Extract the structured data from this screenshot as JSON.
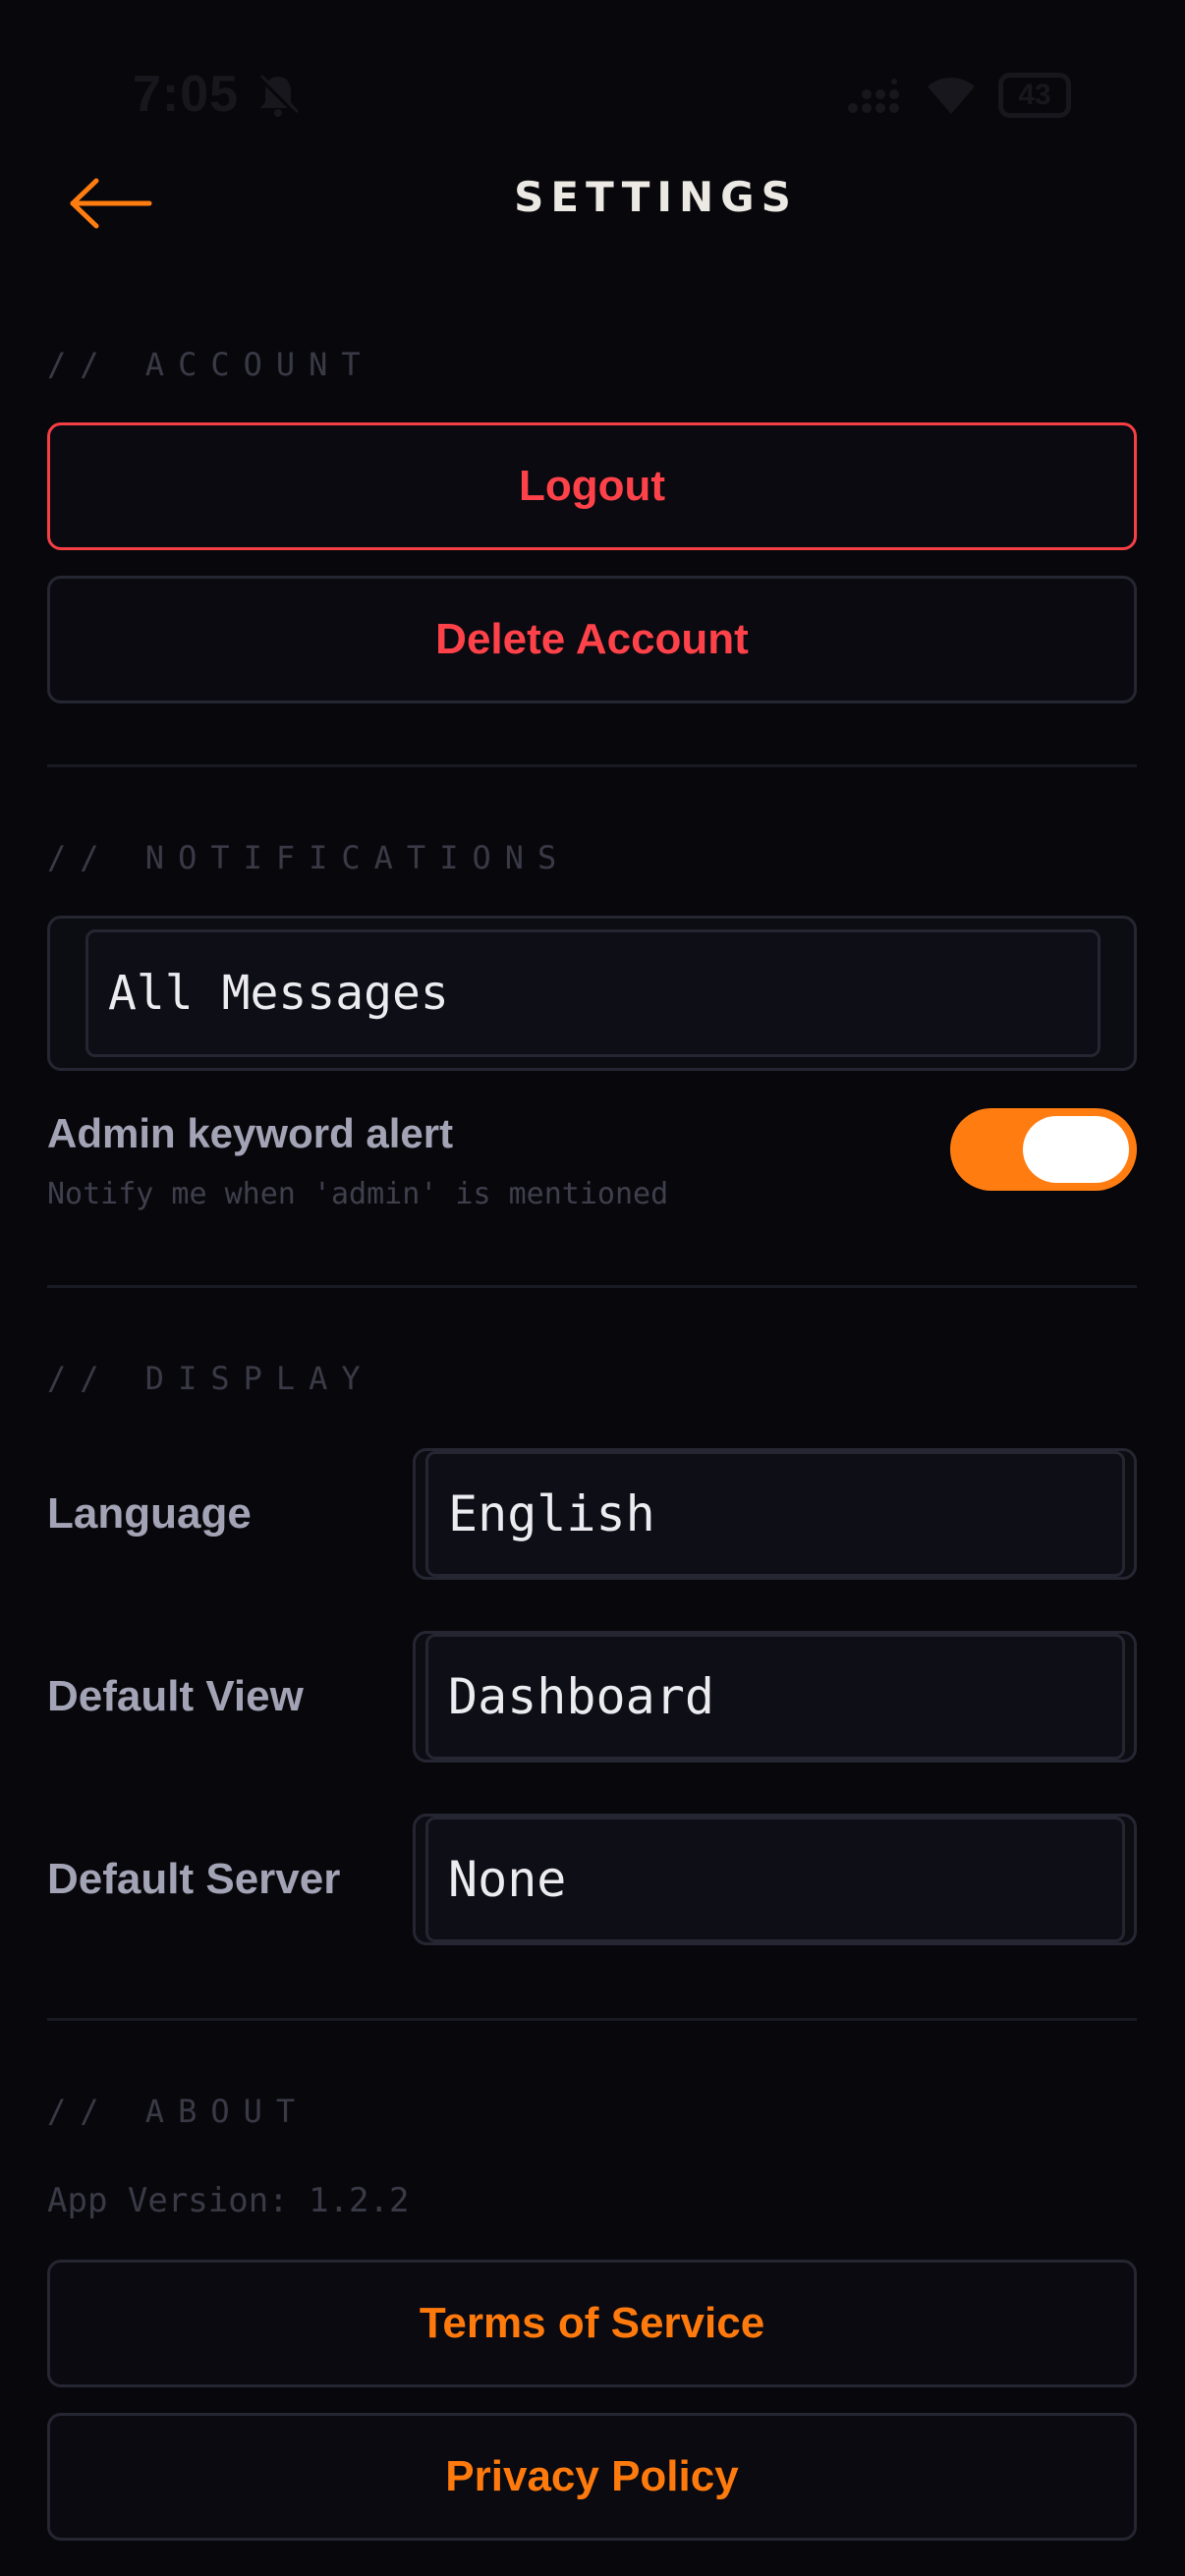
{
  "status_bar": {
    "time": "7:05",
    "battery": "43"
  },
  "header": {
    "title": "SETTINGS",
    "back_icon": "arrow-left-icon"
  },
  "account": {
    "header": "// ACCOUNT",
    "logout_label": "Logout",
    "delete_label": "Delete Account"
  },
  "notifications": {
    "header": "// NOTIFICATIONS",
    "selected": "All Messages",
    "toggle_label": "Admin keyword alert",
    "toggle_desc": "Notify me when 'admin' is mentioned",
    "toggle_on": true
  },
  "display": {
    "header": "// DISPLAY",
    "rows": [
      {
        "label": "Language",
        "value": "English"
      },
      {
        "label": "Default View",
        "value": "Dashboard"
      },
      {
        "label": "Default Server",
        "value": "None"
      }
    ]
  },
  "about": {
    "header": "// ABOUT",
    "app_version": "App Version: 1.2.2",
    "terms_label": "Terms of Service",
    "privacy_label": "Privacy Policy"
  },
  "colors": {
    "background": "#08080c",
    "accent": "#ff7d10",
    "danger": "#ff4249"
  }
}
